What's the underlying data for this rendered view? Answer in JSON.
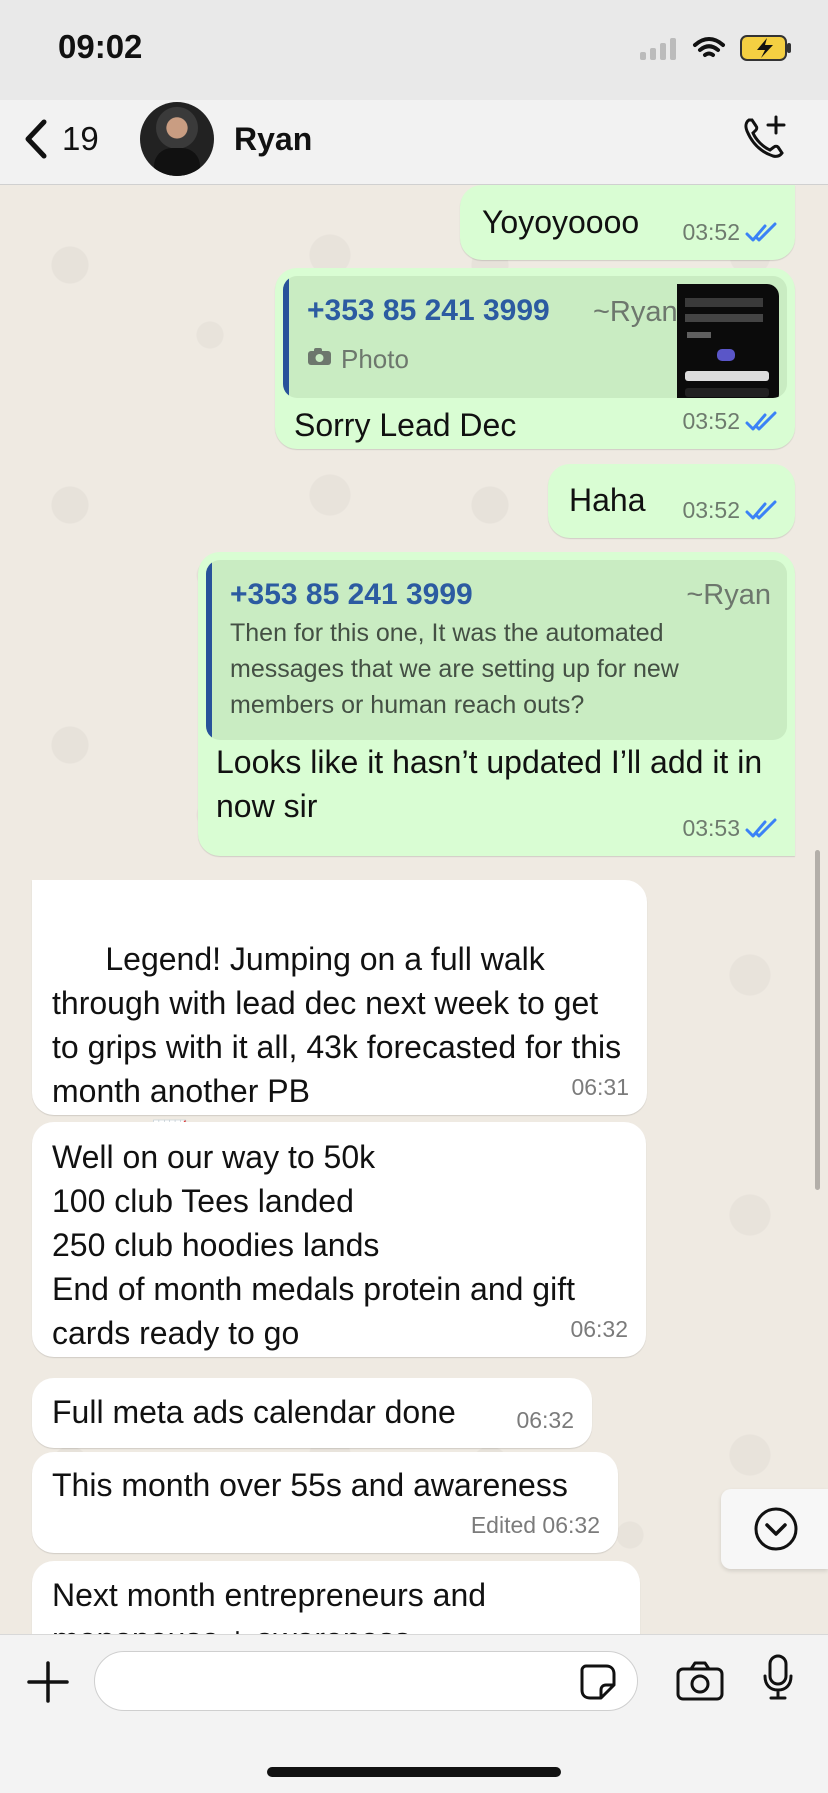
{
  "status": {
    "time": "09:02"
  },
  "header": {
    "back_count": "19",
    "contact_name": "Ryan"
  },
  "messages": [
    {
      "text": "Yoyoyoooo",
      "time": "03:52"
    },
    {
      "quote_author": "+353 85 241 3999",
      "quote_tag": "~Ryan",
      "quote_label": "Photo",
      "text": "Sorry Lead Dec",
      "time": "03:52"
    },
    {
      "text": "Haha",
      "time": "03:52"
    },
    {
      "quote_author": "+353 85 241 3999",
      "quote_tag": "~Ryan",
      "quote_text": "Then for this one, It was the automated messages that we are setting up for new members or human reach outs?",
      "text": "Looks like it hasn’t updated I’ll add it in now sir",
      "time": "03:53"
    },
    {
      "text": "Legend! Jumping on a full walk through with lead dec next week to get to grips with it all, 43k forecasted for this month another PB",
      "emoji": "🤝 📈",
      "time": "06:31"
    },
    {
      "text": "Well on our way to 50k\n100 club Tees landed\n250 club hoodies lands\nEnd of month medals protein and gift cards ready to go",
      "time": "06:32"
    },
    {
      "text": "Full meta ads calendar done",
      "time": "06:32"
    },
    {
      "text": "This month over 55s and awareness",
      "time": "Edited 06:32"
    },
    {
      "text": "Next month entrepreneurs and menopause + awareness"
    }
  ],
  "input": {
    "placeholder": ""
  },
  "icons": {
    "wifi": "wifi-icon",
    "battery": "battery-charging-icon",
    "signal": "signal-icon",
    "back": "chevron-left-icon",
    "call": "add-call-icon",
    "attach": "plus-icon",
    "sticker": "sticker-icon",
    "camera": "camera-icon",
    "microphone": "microphone-icon",
    "scroll": "chevron-down-icon"
  },
  "colors": {
    "outgoing_bubble": "#d9fdd3",
    "incoming_bubble": "#ffffff",
    "quote_accent": "#28529a",
    "read_ticks": "#3b82f6"
  }
}
